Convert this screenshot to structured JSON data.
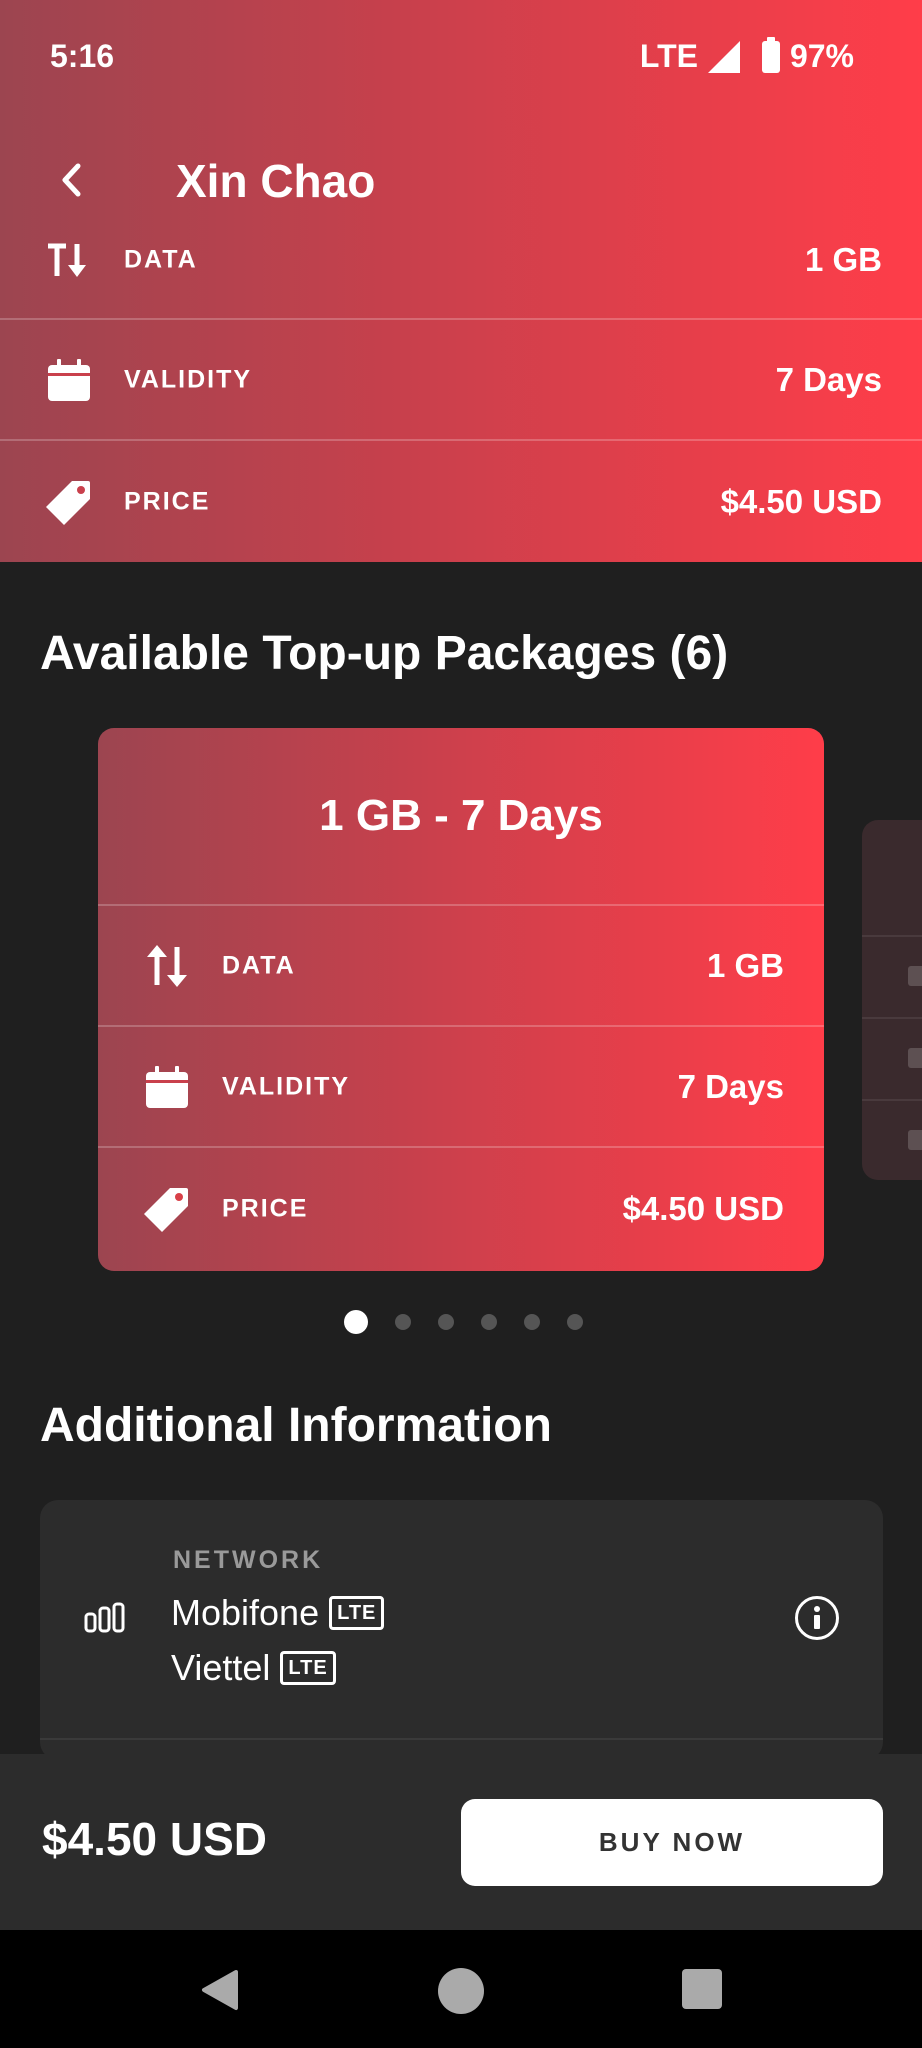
{
  "status_bar": {
    "time": "5:16",
    "network": "LTE",
    "battery": "97%"
  },
  "app_bar": {
    "title": "Xin Chao",
    "back_icon": "chevron-left-icon"
  },
  "summary": [
    {
      "icon": "data-transfer-icon",
      "label": "DATA",
      "value": "1 GB"
    },
    {
      "icon": "calendar-icon",
      "label": "VALIDITY",
      "value": "7 Days"
    },
    {
      "icon": "price-tag-icon",
      "label": "PRICE",
      "value": "$4.50 USD"
    }
  ],
  "packages": {
    "heading": "Available Top-up Packages (6)",
    "count": 6,
    "active_index": 0,
    "current": {
      "title": "1 GB - 7 Days",
      "rows": [
        {
          "icon": "data-transfer-icon",
          "label": "DATA",
          "value": "1 GB"
        },
        {
          "icon": "calendar-icon",
          "label": "VALIDITY",
          "value": "7 Days"
        },
        {
          "icon": "price-tag-icon",
          "label": "PRICE",
          "value": "$4.50 USD"
        }
      ]
    }
  },
  "additional_info": {
    "heading": "Additional Information",
    "network": {
      "label": "NETWORK",
      "operators": [
        {
          "name": "Mobifone",
          "badge": "LTE"
        },
        {
          "name": "Viettel",
          "badge": "LTE"
        }
      ]
    }
  },
  "bottom_bar": {
    "price": "$4.50 USD",
    "buy_label": "BUY NOW"
  },
  "colors": {
    "gradient_start": "#9c4550",
    "gradient_end": "#ff3d49",
    "background": "#1f1f1f",
    "card": "#2c2c2c"
  }
}
